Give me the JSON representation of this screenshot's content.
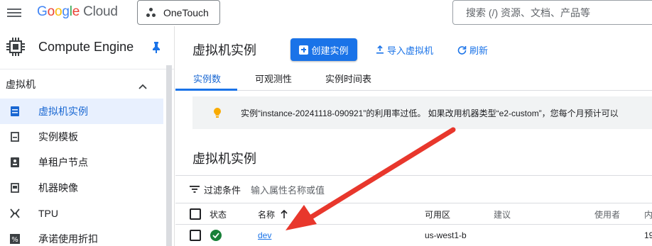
{
  "topbar": {
    "logo_google_letters": [
      "G",
      "o",
      "o",
      "g",
      "l",
      "e"
    ],
    "logo_cloud": "Cloud",
    "project_name": "OneTouch",
    "search_placeholder": "搜索 (/) 资源、文档、产品等"
  },
  "sidebar": {
    "product_title": "Compute Engine",
    "section_label": "虚拟机",
    "items": [
      {
        "label": "虚拟机实例",
        "icon": "vm-instance-icon",
        "active": true
      },
      {
        "label": "实例模板",
        "icon": "instance-template-icon",
        "active": false
      },
      {
        "label": "单租户节点",
        "icon": "sole-tenant-node-icon",
        "active": false
      },
      {
        "label": "机器映像",
        "icon": "machine-image-icon",
        "active": false
      },
      {
        "label": "TPU",
        "icon": "tpu-icon",
        "active": false
      },
      {
        "label": "承诺使用折扣",
        "icon": "percent-icon",
        "active": false
      }
    ]
  },
  "main": {
    "page_title": "虚拟机实例",
    "create_button": "创建实例",
    "import_button": "导入虚拟机",
    "refresh_button": "刷新",
    "tabs": [
      {
        "label": "实例数",
        "active": true
      },
      {
        "label": "可观测性",
        "active": false
      },
      {
        "label": "实例时间表",
        "active": false
      }
    ],
    "banner_text": "实例“instance-20241118-090921”的利用率过低。 如果改用机器类型“e2-custom”，您每个月预计可以",
    "section_title": "虚拟机实例",
    "filter_label": "过滤条件",
    "filter_placeholder": "输入属性名称或值",
    "table": {
      "columns": [
        "状态",
        "名称",
        "可用区",
        "建议",
        "使用者",
        "内"
      ],
      "rows": [
        {
          "status": "running",
          "name": "dev",
          "zone": "us-west1-b",
          "recommendation": "",
          "used_by": "",
          "internal_ip": "19"
        }
      ]
    }
  },
  "colors": {
    "accent": "#1a73e8",
    "status_ok": "#188038",
    "annotation_arrow": "#e8372c",
    "bulb": "#f9ab00"
  }
}
